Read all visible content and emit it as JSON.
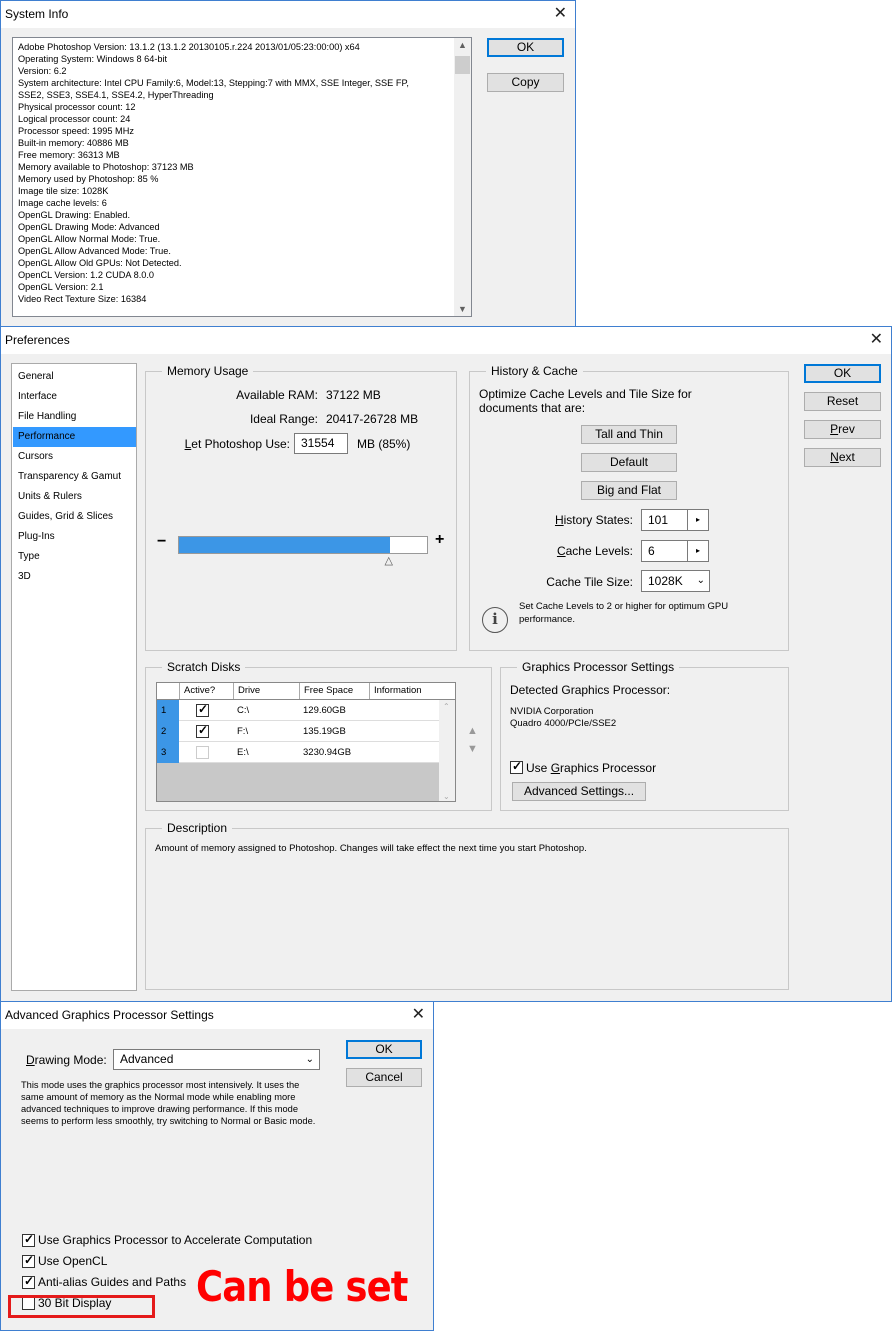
{
  "system_info": {
    "title": "System Info",
    "lines": [
      "Adobe Photoshop Version: 13.1.2 (13.1.2 20130105.r.224 2013/01/05:23:00:00) x64",
      "Operating System: Windows 8 64-bit",
      "Version: 6.2",
      "System architecture: Intel CPU Family:6, Model:13, Stepping:7 with MMX, SSE Integer, SSE FP,",
      "SSE2, SSE3, SSE4.1, SSE4.2, HyperThreading",
      "Physical processor count: 12",
      "Logical processor count: 24",
      "Processor speed: 1995 MHz",
      "Built-in memory: 40886 MB",
      "Free memory: 36313 MB",
      "Memory available to Photoshop: 37123 MB",
      "Memory used by Photoshop: 85 %",
      "Image tile size: 1028K",
      "Image cache levels: 6",
      "OpenGL Drawing: Enabled.",
      "OpenGL Drawing Mode: Advanced",
      "OpenGL Allow Normal Mode: True.",
      "OpenGL Allow Advanced Mode: True.",
      "OpenGL Allow Old GPUs: Not Detected.",
      "OpenCL Version: 1.2 CUDA 8.0.0",
      "OpenGL Version: 2.1",
      "Video Rect Texture Size: 16384"
    ],
    "ok_label": "OK",
    "copy_label": "Copy"
  },
  "preferences": {
    "title": "Preferences",
    "nav": [
      "General",
      "Interface",
      "File Handling",
      "Performance",
      "Cursors",
      "Transparency & Gamut",
      "Units & Rulers",
      "Guides, Grid & Slices",
      "Plug-Ins",
      "Type",
      "3D"
    ],
    "selected_nav": "Performance",
    "memory": {
      "title": "Memory Usage",
      "available_label": "Available RAM:",
      "available_value": "37122 MB",
      "ideal_label": "Ideal Range:",
      "ideal_value": "20417-26728 MB",
      "let_label_pre": "L",
      "let_label_rest": "et Photoshop Use:",
      "let_value": "31554",
      "let_suffix": "MB (85%)",
      "minus": "−",
      "plus": "+",
      "slider_fraction": 0.85
    },
    "history": {
      "title": "History & Cache",
      "desc": "Optimize Cache Levels and Tile Size for documents that are:",
      "btn_tall": "Tall and Thin",
      "btn_default": "Default",
      "btn_big": "Big and Flat",
      "states_label_pre": "H",
      "states_label_rest": "istory States:",
      "states_value": "101",
      "levels_label_pre": "C",
      "levels_label_rest": "ache Levels:",
      "levels_value": "6",
      "tile_label": "Cache Tile Size:",
      "tile_value": "1028K",
      "info_text": "Set Cache Levels to 2 or higher for optimum GPU performance."
    },
    "scratch": {
      "title": "Scratch Disks",
      "headers": [
        "Active?",
        "Drive",
        "Free Space",
        "Information"
      ],
      "rows": [
        {
          "num": "1",
          "active": true,
          "drive": "C:\\",
          "free": "129.60GB",
          "info": ""
        },
        {
          "num": "2",
          "active": true,
          "drive": "F:\\",
          "free": "135.19GB",
          "info": ""
        },
        {
          "num": "3",
          "active": false,
          "drive": "E:\\",
          "free": "3230.94GB",
          "info": ""
        }
      ]
    },
    "gpu": {
      "title": "Graphics Processor Settings",
      "detected_label": "Detected Graphics Processor:",
      "vendor": "NVIDIA Corporation",
      "model": "Quadro 4000/PCIe/SSE2",
      "use_label_pre": "Use ",
      "use_label_u": "G",
      "use_label_rest": "raphics Processor",
      "use_checked": true,
      "advanced_label": "Advanced Settings..."
    },
    "description": {
      "title": "Description",
      "text": "Amount of memory assigned to Photoshop. Changes will take effect the next time you start Photoshop."
    },
    "buttons": {
      "ok": "OK",
      "reset": "Reset",
      "prev_u": "P",
      "prev_rest": "rev",
      "next_u": "N",
      "next_rest": "ext"
    }
  },
  "advanced": {
    "title": "Advanced Graphics Processor Settings",
    "mode_label_u": "D",
    "mode_label_rest": "rawing Mode:",
    "mode_value": "Advanced",
    "mode_desc": "This mode uses the graphics processor most intensively.  It uses the same amount of memory as the Normal mode while enabling more advanced techniques to improve drawing performance.  If this mode seems to perform less smoothly, try switching to Normal or Basic mode.",
    "ok_label": "OK",
    "cancel_label": "Cancel",
    "options": [
      {
        "label": "Use Graphics Processor to Accelerate Computation",
        "checked": true
      },
      {
        "label": "Use OpenCL",
        "checked": true
      },
      {
        "label": "Anti-alias Guides and Paths",
        "checked": true
      },
      {
        "label": "30 Bit Display",
        "checked": false
      }
    ],
    "annotation": "Can be set",
    "annotation_color": "#ff0000"
  }
}
